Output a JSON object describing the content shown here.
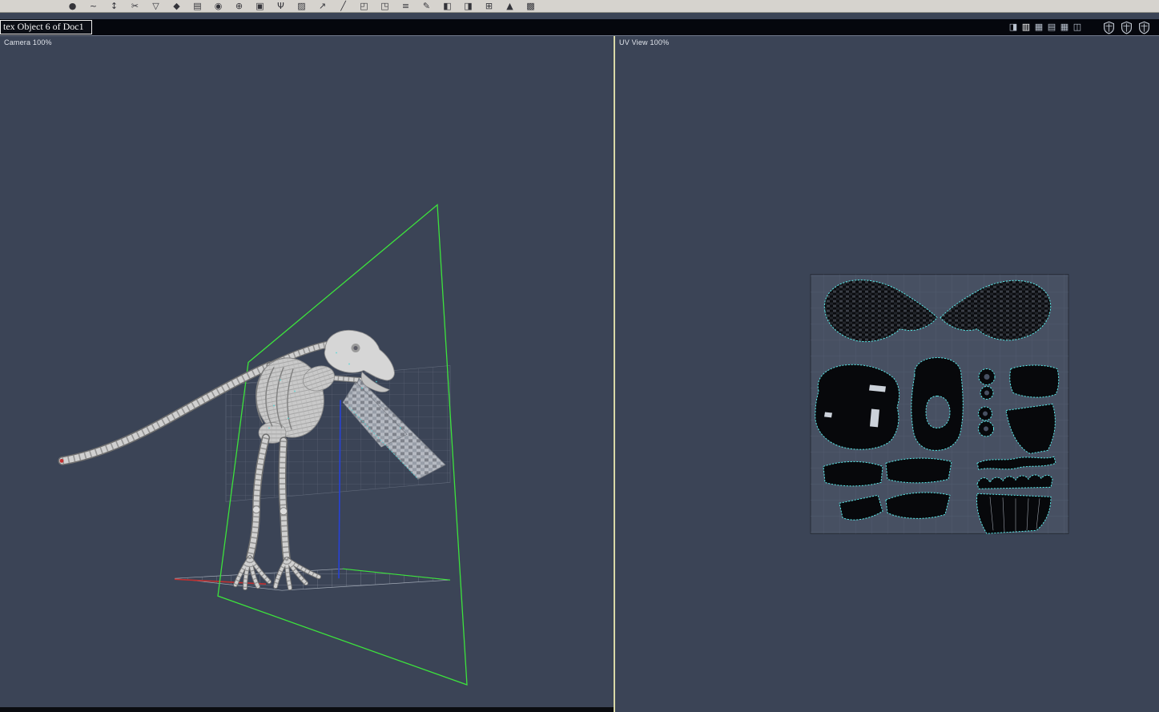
{
  "window": {
    "title": "tex Object 6 of Doc1"
  },
  "toolbar": {
    "icons": [
      {
        "name": "sphere-tool",
        "glyph": "●"
      },
      {
        "name": "spline-tool",
        "glyph": "~"
      },
      {
        "name": "stretch-tool",
        "glyph": "↕"
      },
      {
        "name": "scissors-tool",
        "glyph": "✂"
      },
      {
        "name": "pin-tool",
        "glyph": "▽"
      },
      {
        "name": "shear-tool",
        "glyph": "◆"
      },
      {
        "name": "relax-tool",
        "glyph": "▤"
      },
      {
        "name": "target-weld-tool",
        "glyph": "◉"
      },
      {
        "name": "weld-tool",
        "glyph": "⊕"
      },
      {
        "name": "pack-tool",
        "glyph": "▣"
      },
      {
        "name": "anchor-tool",
        "glyph": "Ψ"
      },
      {
        "name": "delete-face-tool",
        "glyph": "▨"
      },
      {
        "name": "project-tool",
        "glyph": "↗"
      },
      {
        "name": "line-tool",
        "glyph": "╱"
      },
      {
        "name": "rotate-left-tool",
        "glyph": "◰"
      },
      {
        "name": "rotate-right-tool",
        "glyph": "◳"
      },
      {
        "name": "stack-tool",
        "glyph": "≡"
      },
      {
        "name": "pen-tool",
        "glyph": "✎"
      },
      {
        "name": "mirror-h-tool",
        "glyph": "◧"
      },
      {
        "name": "mirror-v-tool",
        "glyph": "◨"
      },
      {
        "name": "grid-snap-tool",
        "glyph": "⊞"
      },
      {
        "name": "prism-tool",
        "glyph": "▲"
      },
      {
        "name": "texture-fill-tool",
        "glyph": "▩"
      }
    ]
  },
  "titlebar": {
    "layout_icons": [
      {
        "name": "layout-one-icon",
        "glyph": "◨"
      },
      {
        "name": "layout-two-columns-icon",
        "glyph": "▥"
      },
      {
        "name": "layout-grid-icon",
        "glyph": "▦"
      },
      {
        "name": "layout-rows-icon",
        "glyph": "▤"
      },
      {
        "name": "layout-quad-icon",
        "glyph": "▦"
      },
      {
        "name": "layout-split-icon",
        "glyph": "◫"
      }
    ],
    "shield_icons": [
      {
        "name": "shield-toggle-1-icon"
      },
      {
        "name": "shield-toggle-2-icon"
      },
      {
        "name": "shield-toggle-3-icon"
      }
    ]
  },
  "viewports": {
    "camera": {
      "label": "Camera 100%"
    },
    "uv": {
      "label": "UV View 100%"
    }
  },
  "colors": {
    "background": "#3b4456",
    "toolbar_bg": "#d6d3ce",
    "titlebar_bg": "#05070d",
    "frustum_green": "#3ce23c",
    "uv_outline_cyan": "#58e4e4",
    "divider_yellow": "#d9d9a8",
    "axis_blue": "#2742d8",
    "axis_red": "#c03030",
    "bone_gray": "#d0d0d0"
  }
}
